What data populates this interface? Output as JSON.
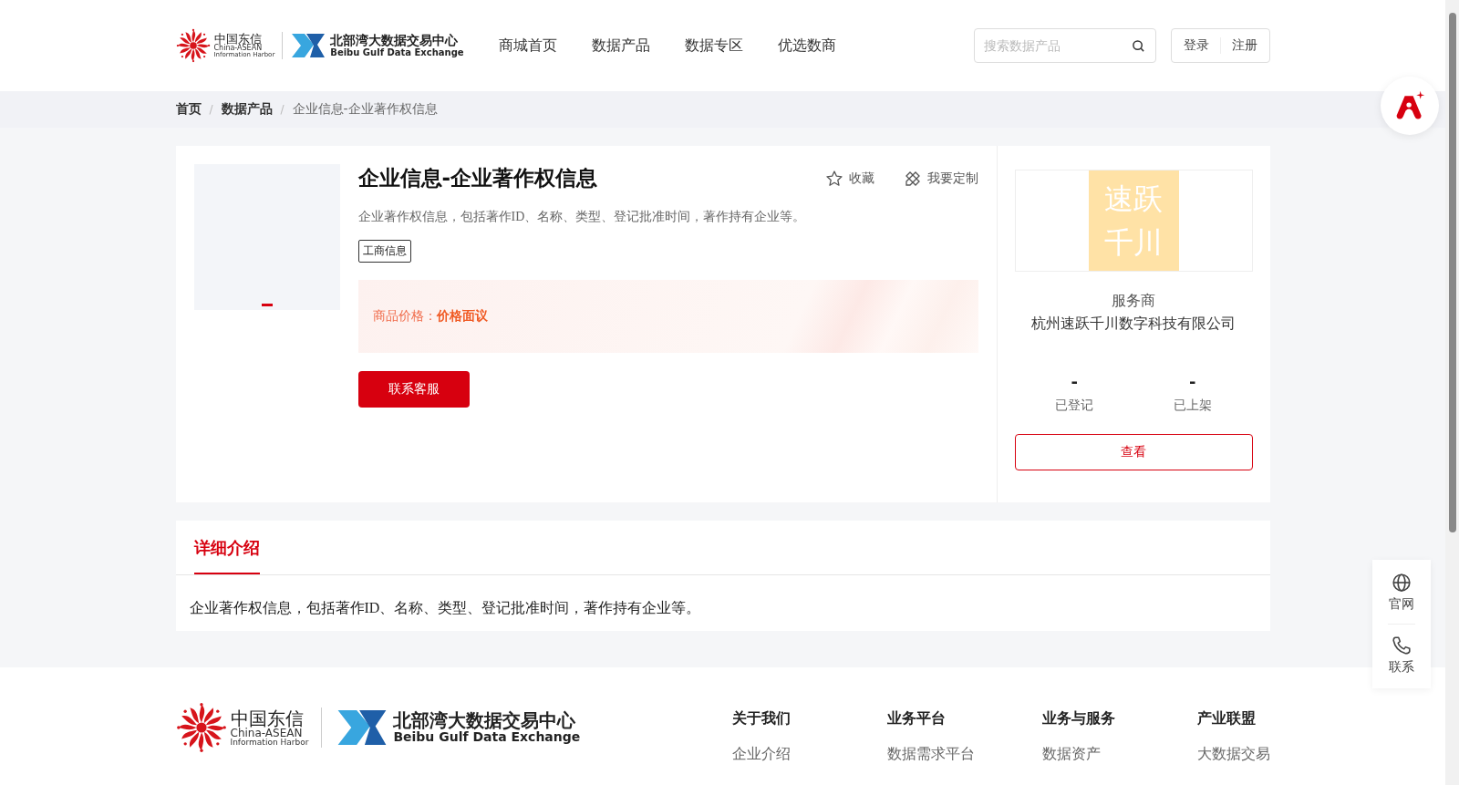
{
  "header": {
    "logo": {
      "cn": "中国东信",
      "en1": "China-ASEAN",
      "en2": "Information Harbor",
      "bbw_cn": "北部湾大数据交易中心",
      "bbw_en": "Beibu Gulf Data Exchange"
    },
    "nav": [
      {
        "label": "商城首页",
        "selected": false
      },
      {
        "label": "数据产品",
        "selected": false
      },
      {
        "label": "数据专区",
        "selected": false
      },
      {
        "label": "优选数商",
        "selected": false
      }
    ],
    "search": {
      "placeholder": "搜索数据产品"
    },
    "auth": [
      "登录",
      "注册"
    ]
  },
  "breadcrumb": [
    {
      "label": "首页",
      "current": false
    },
    {
      "separator": "/",
      "label": "数据产品",
      "current": false
    },
    {
      "separator": "/",
      "label": "企业信息-企业著作权信息",
      "current": true
    }
  ],
  "product": {
    "title": "企业信息-企业著作权信息",
    "actions": [
      {
        "kind": "star",
        "label": "收藏"
      },
      {
        "kind": "custom",
        "label": "我要定制"
      }
    ],
    "description": "企业著作权信息，包括著作ID、名称、类型、登记批准时间，著作持有企业等。",
    "tags": [
      "工商信息"
    ],
    "price_label": "商品价格：",
    "price_value": "价格面议",
    "contact_button": "联系客服"
  },
  "provider": {
    "logo_lines": [
      "速跃",
      "千川"
    ],
    "role": "服务商",
    "name": "杭州速跃千川数字科技有限公司",
    "stats": [
      {
        "value": "-",
        "label": "已登记"
      },
      {
        "value": "-",
        "label": "已上架"
      }
    ],
    "view_button": "查看"
  },
  "details": {
    "tabs": [
      {
        "label": "详细介绍",
        "selected": true
      }
    ],
    "text": "企业著作权信息，包括著作ID、名称、类型、登记批准时间，著作持有企业等。"
  },
  "side_panel": [
    {
      "kind": "globe",
      "label": "官网"
    },
    {
      "kind": "phone",
      "label": "联系"
    }
  ],
  "footer": {
    "logo": {
      "cn": "中国东信",
      "en1": "China-ASEAN",
      "en2": "Information Harbor",
      "bbw_cn": "北部湾大数据交易中心",
      "bbw_en": "Beibu Gulf Data Exchange"
    },
    "columns": [
      {
        "title": "关于我们",
        "links": [
          "企业介绍"
        ]
      },
      {
        "title": "业务平台",
        "links": [
          "数据需求平台"
        ]
      },
      {
        "title": "业务与服务",
        "links": [
          "数据资产"
        ]
      },
      {
        "title": "产业联盟",
        "links": [
          "大数据交易"
        ]
      }
    ]
  }
}
